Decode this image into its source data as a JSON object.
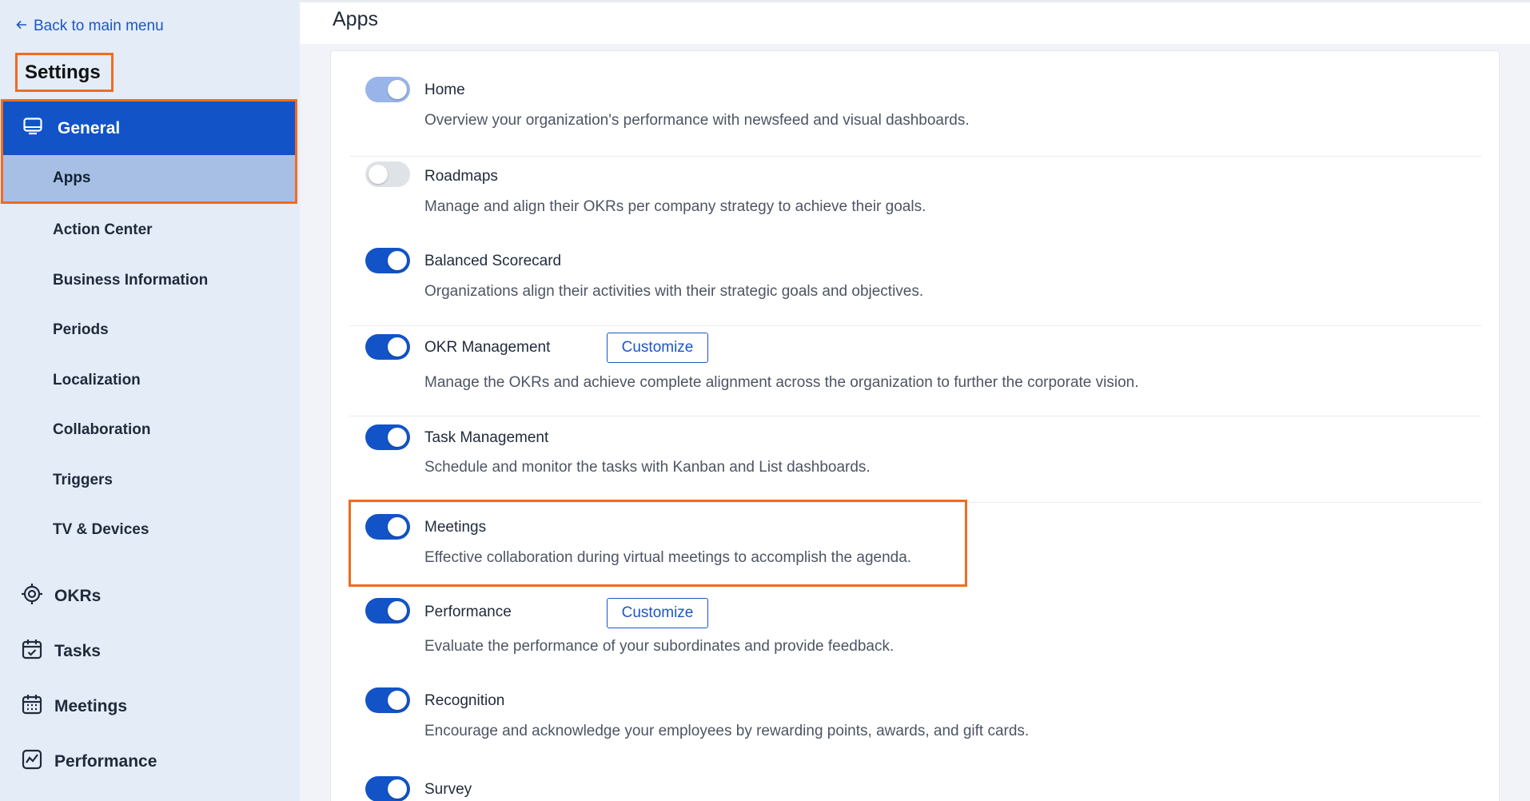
{
  "sidebar": {
    "back_label": "Back to main menu",
    "title": "Settings",
    "general_label": "General",
    "apps_label": "Apps",
    "sub_items": [
      "Action Center",
      "Business Information",
      "Periods",
      "Localization",
      "Collaboration",
      "Triggers",
      "TV & Devices"
    ],
    "main_items": [
      {
        "label": "OKRs",
        "icon": "target-icon"
      },
      {
        "label": "Tasks",
        "icon": "calendar-check-icon"
      },
      {
        "label": "Meetings",
        "icon": "calendar-icon"
      },
      {
        "label": "Performance",
        "icon": "chart-icon"
      }
    ]
  },
  "header": {
    "title": "Apps"
  },
  "apps": [
    {
      "name": "Home",
      "desc": "Overview your organization's performance with newsfeed and visual dashboards.",
      "state": "on-light",
      "customize": ""
    },
    {
      "name": "Roadmaps",
      "desc": "Manage and align their OKRs per company strategy to achieve their goals.",
      "state": "off",
      "customize": ""
    },
    {
      "name": "Balanced Scorecard",
      "desc": "Organizations align their activities with their strategic goals and objectives.",
      "state": "on",
      "customize": ""
    },
    {
      "name": "OKR Management",
      "desc": "Manage the OKRs and achieve complete alignment across the organization to further the corporate vision.",
      "state": "on",
      "customize": "Customize"
    },
    {
      "name": "Task Management",
      "desc": "Schedule and monitor the tasks with Kanban and List dashboards.",
      "state": "on",
      "customize": ""
    },
    {
      "name": "Meetings",
      "desc": "Effective collaboration during virtual meetings to accomplish the agenda.",
      "state": "on",
      "customize": ""
    },
    {
      "name": "Performance",
      "desc": "Evaluate the performance of your subordinates and provide feedback.",
      "state": "on",
      "customize": "Customize"
    },
    {
      "name": "Recognition",
      "desc": "Encourage and acknowledge your employees by rewarding points, awards, and gift cards.",
      "state": "on",
      "customize": ""
    },
    {
      "name": "Survey",
      "desc": "",
      "state": "on",
      "customize": ""
    }
  ],
  "colors": {
    "primary": "#1254c7",
    "highlight": "#f26b1d",
    "sidebar_bg": "#e4ecf8",
    "selected_sub_bg": "#a8bfe5"
  }
}
